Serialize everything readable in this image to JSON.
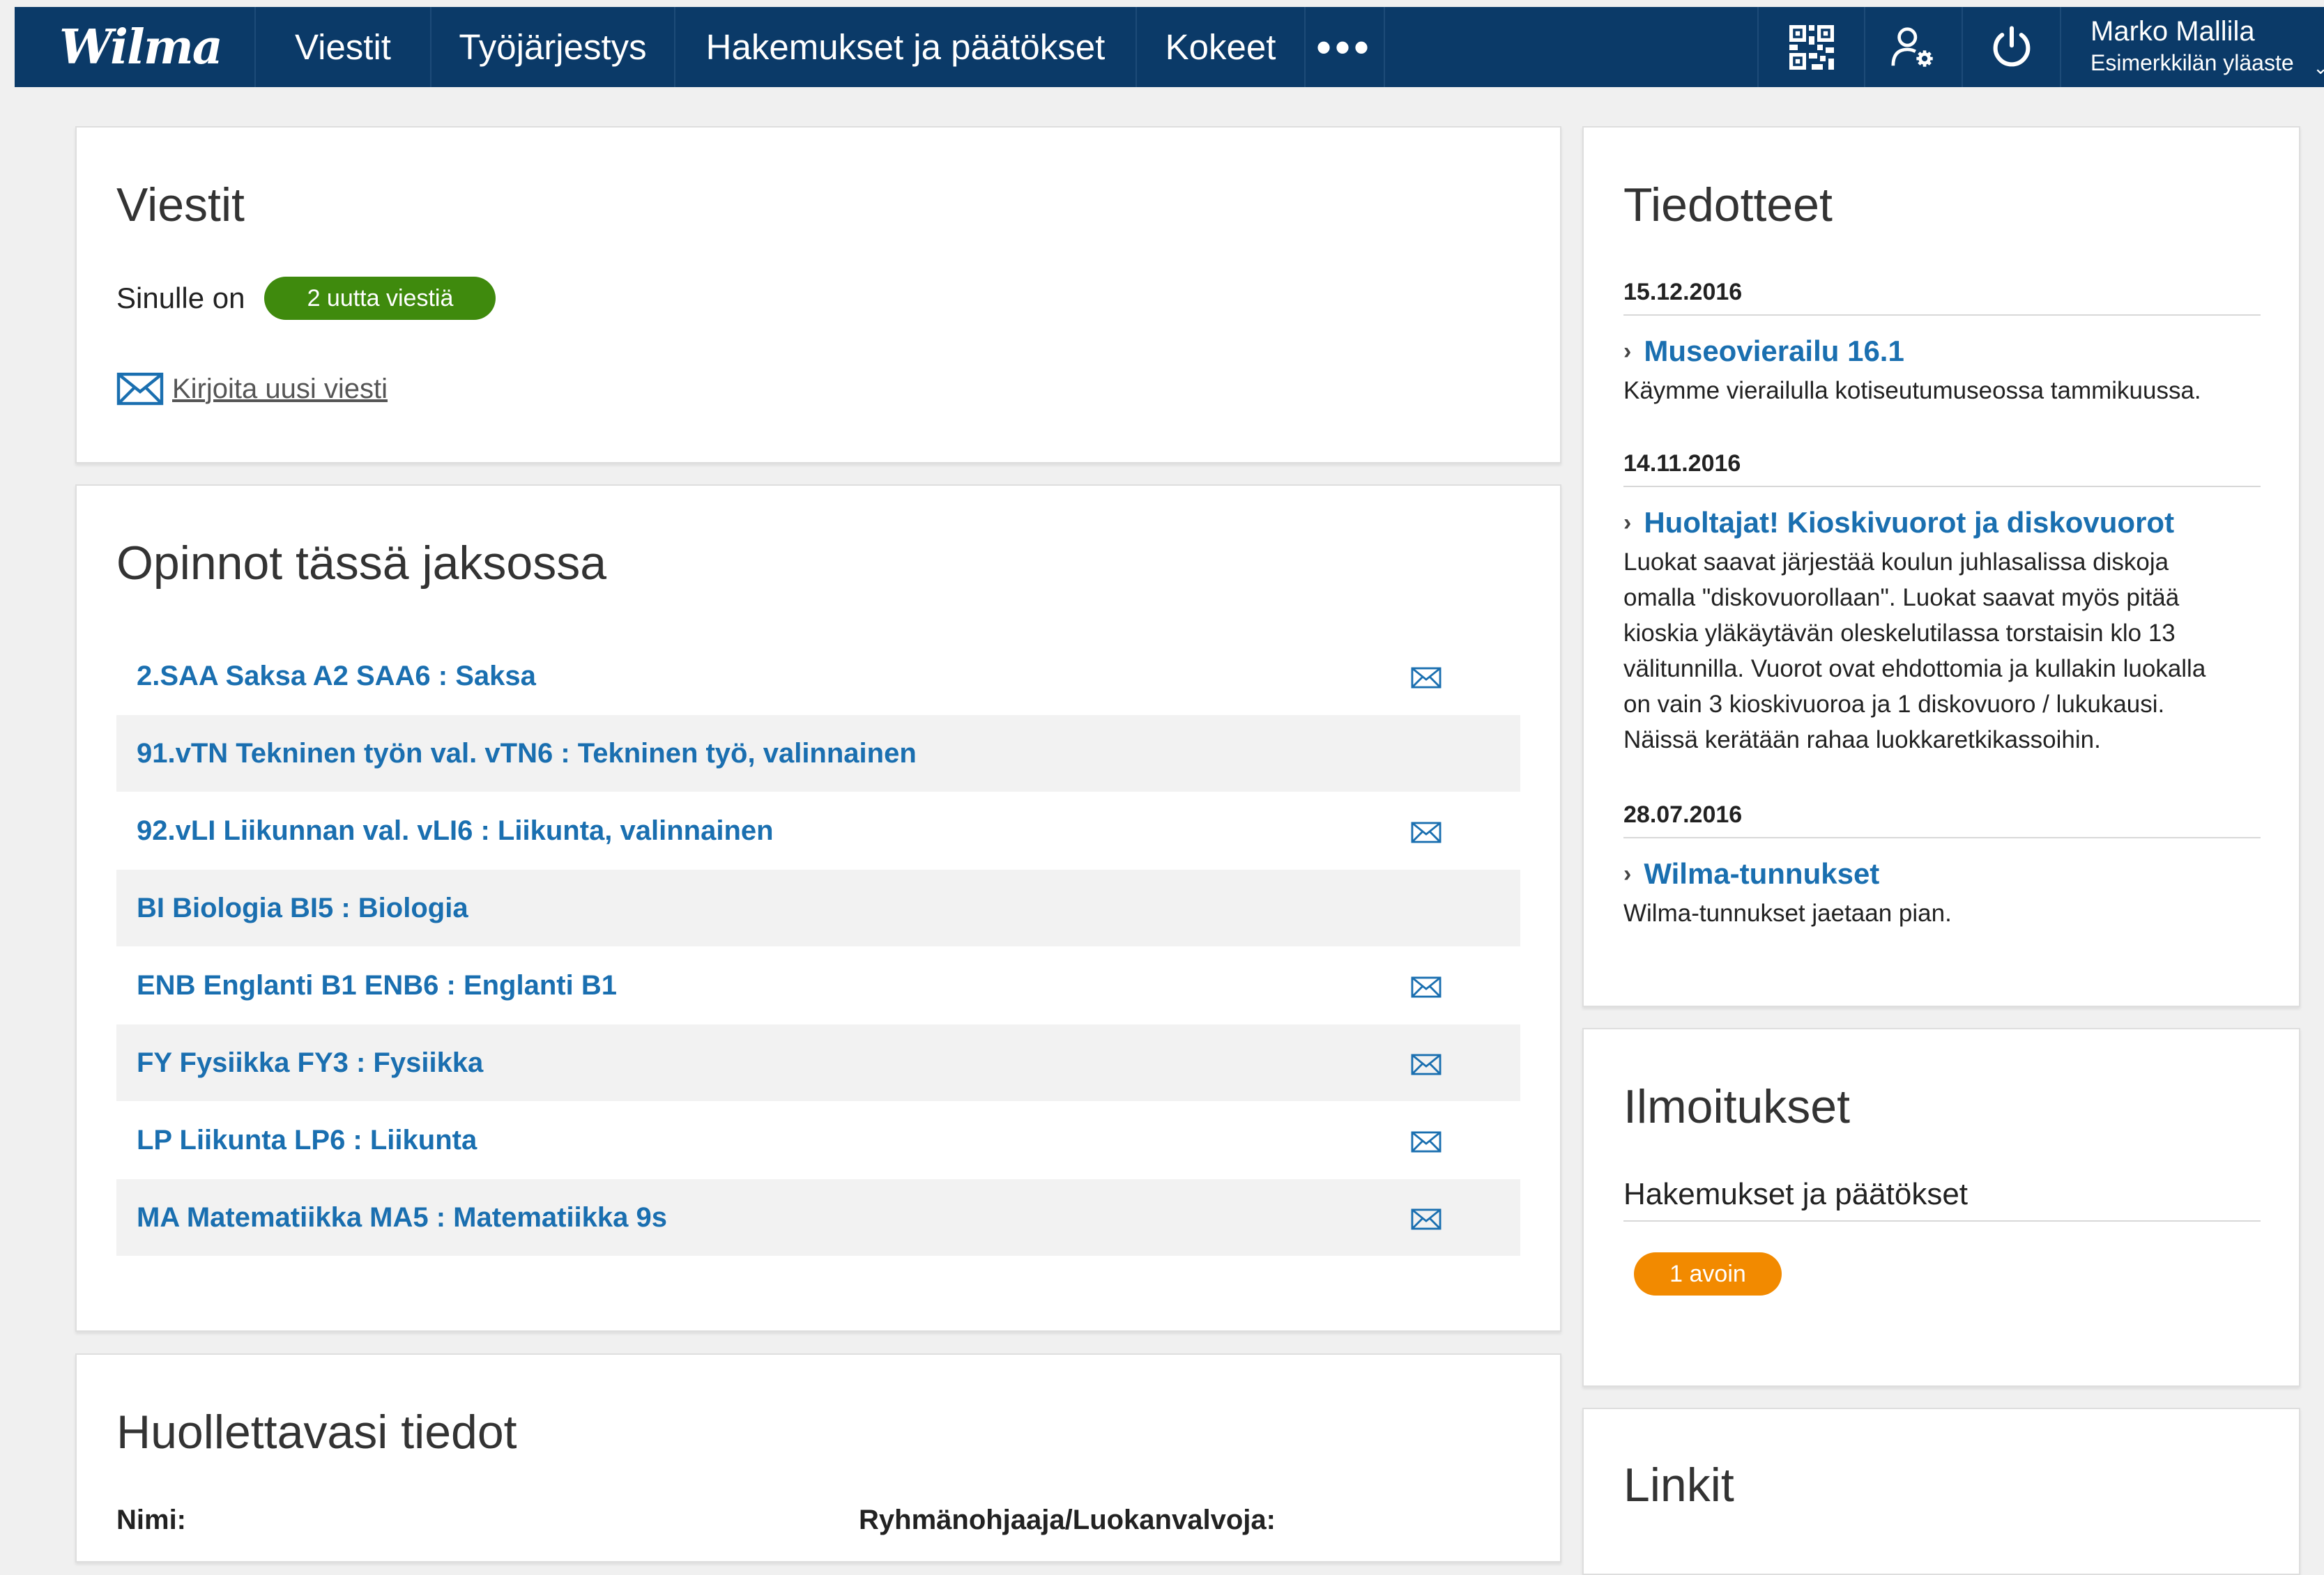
{
  "header": {
    "logo": "Wilma",
    "nav": [
      "Viestit",
      "Työjärjestys",
      "Hakemukset ja päätökset",
      "Kokeet"
    ],
    "more": "•••",
    "user_name": "Marko Mallila",
    "user_school": "Esimerkkilän yläaste"
  },
  "viestit": {
    "title": "Viestit",
    "intro": "Sinulle on",
    "badge": "2 uutta viestiä",
    "compose": "Kirjoita uusi viesti"
  },
  "opinnot": {
    "title": "Opinnot tässä jaksossa",
    "courses": [
      {
        "label": "2.SAA Saksa A2 SAA6 : Saksa",
        "mail": true
      },
      {
        "label": "91.vTN Tekninen työn val. vTN6 : Tekninen työ, valinnainen",
        "mail": false
      },
      {
        "label": "92.vLI Liikunnan val. vLI6 : Liikunta, valinnainen",
        "mail": true
      },
      {
        "label": "BI Biologia BI5 : Biologia",
        "mail": false
      },
      {
        "label": "ENB Englanti B1 ENB6 : Englanti B1",
        "mail": true
      },
      {
        "label": "FY Fysiikka FY3 : Fysiikka",
        "mail": true
      },
      {
        "label": "LP Liikunta LP6 : Liikunta",
        "mail": true
      },
      {
        "label": "MA Matematiikka MA5 : Matematiikka 9s",
        "mail": true
      }
    ]
  },
  "huollettava": {
    "title": "Huollettavasi tiedot",
    "name_label": "Nimi:",
    "teacher_label": "Ryhmänohjaaja/Luokanvalvoja:"
  },
  "tiedotteet": {
    "title": "Tiedotteet",
    "items": [
      {
        "date": "15.12.2016",
        "title": "Museovierailu 16.1",
        "body": [
          "Käymme vierailulla kotiseutumuseossa tammikuussa."
        ]
      },
      {
        "date": "14.11.2016",
        "title": "Huoltajat! Kioskivuorot ja diskovuorot",
        "body": [
          "Luokat saavat järjestää koulun juhlasalissa diskoja",
          "omalla \"diskovuorollaan\". Luokat saavat myös pitää",
          "kioskia yläkäytävän oleskelutilassa torstaisin klo 13",
          "välitunnilla. Vuorot ovat ehdottomia ja kullakin luokalla",
          "on vain 3 kioskivuoroa ja 1 diskovuoro / lukukausi.",
          "Näissä kerätään rahaa luokkaretkikassoihin."
        ]
      },
      {
        "date": "28.07.2016",
        "title": "Wilma-tunnukset",
        "body": [
          "Wilma-tunnukset jaetaan pian."
        ]
      }
    ]
  },
  "ilmoitukset": {
    "title": "Ilmoitukset",
    "subtitle": "Hakemukset ja päätökset",
    "badge": "1 avoin"
  },
  "linkit": {
    "title": "Linkit"
  }
}
